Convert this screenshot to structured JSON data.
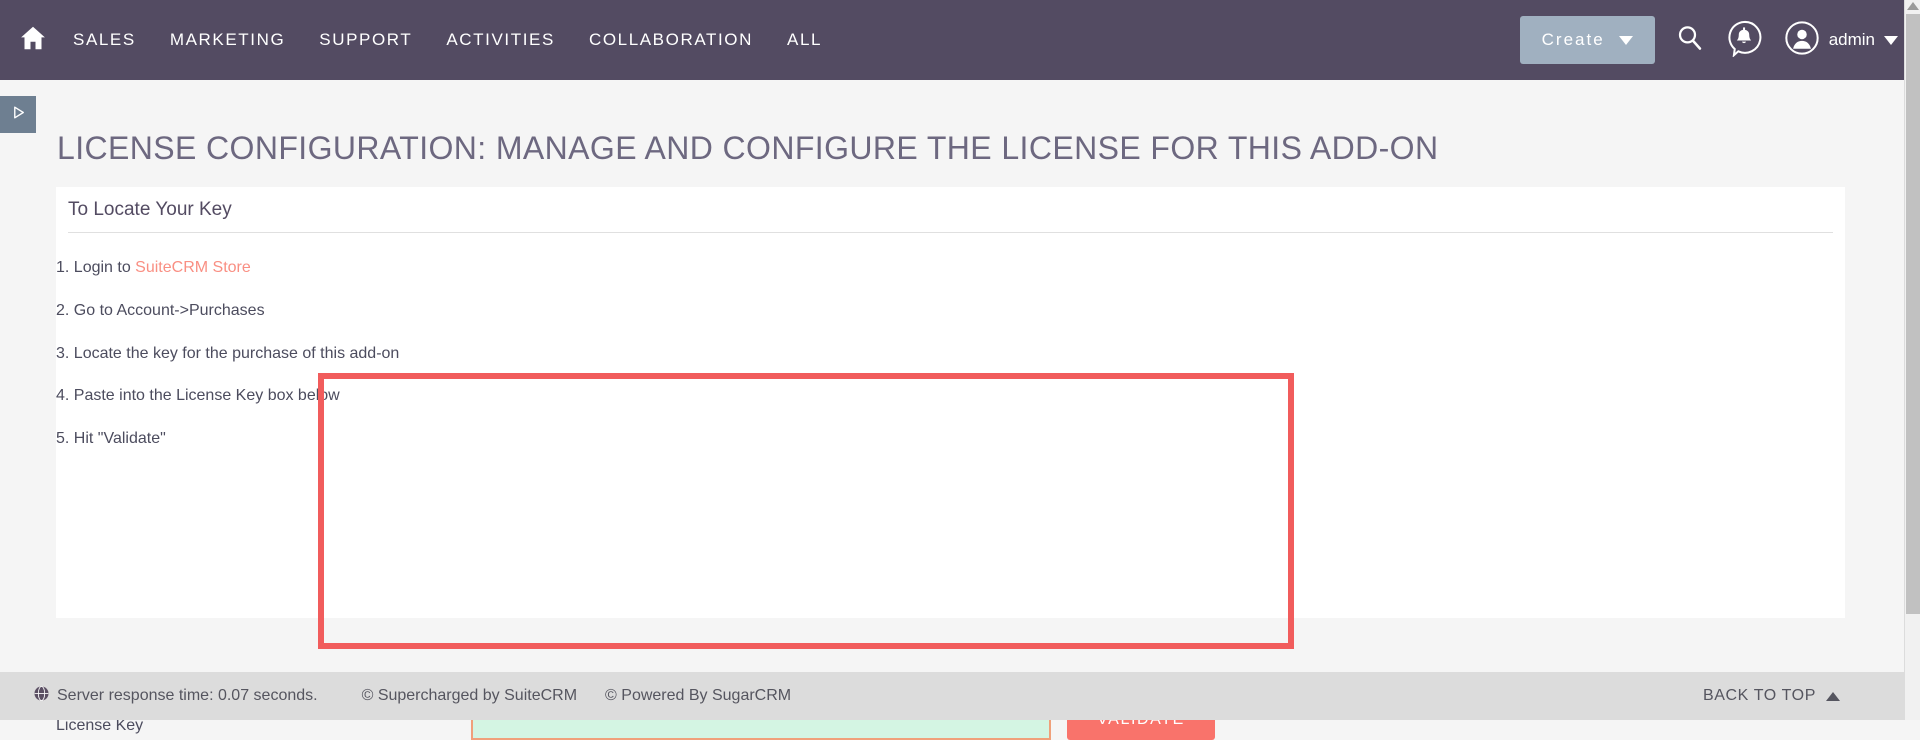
{
  "topnav": {
    "home_icon": "home-icon",
    "links": [
      {
        "label": "Sales"
      },
      {
        "label": "Marketing"
      },
      {
        "label": "Support"
      },
      {
        "label": "Activities"
      },
      {
        "label": "Collaboration"
      },
      {
        "label": "All"
      }
    ],
    "create_label": "Create",
    "search_icon": "search-icon",
    "notifications_icon": "notification-bell-icon",
    "user_icon": "user-avatar-icon",
    "user_name": "admin",
    "colors": {
      "navbar_bg": "#534b62",
      "create_bg": "#a0b0c0"
    }
  },
  "sidebar_toggle": {
    "icon": "expand-sidebar-triangle-icon"
  },
  "page": {
    "title": "License Configuration: Manage and configure the license for this add-on"
  },
  "panel": {
    "header": "To Locate Your Key",
    "steps": [
      {
        "prefix": "1. Login to ",
        "link": "SuiteCRM Store",
        "suffix": ""
      },
      {
        "prefix": "2. Go to Account->Purchases",
        "link": "",
        "suffix": ""
      },
      {
        "prefix": "3. Locate the key for the purchase of this add-on",
        "link": "",
        "suffix": ""
      },
      {
        "prefix": "4. Paste into the License Key box below",
        "link": "",
        "suffix": ""
      },
      {
        "prefix": "5. Hit \"Validate\"",
        "link": "",
        "suffix": ""
      }
    ],
    "license_key_label": "License Key",
    "license_key_value": "",
    "license_key_placeholder": "",
    "validate_label": "Validate",
    "colors": {
      "input_bg": "#d4f5e3",
      "input_border": "#f0a07a",
      "validate_bg": "#f9736b",
      "link": "#f98f83"
    }
  },
  "annotation": {
    "color": "#f15c5c"
  },
  "footer": {
    "globe_icon": "globe-icon",
    "server_response": "Server response time: 0.07 seconds.",
    "supercharged": "© Supercharged by SuiteCRM",
    "powered": "© Powered By SugarCRM",
    "back_to_top": "BACK TO TOP"
  }
}
